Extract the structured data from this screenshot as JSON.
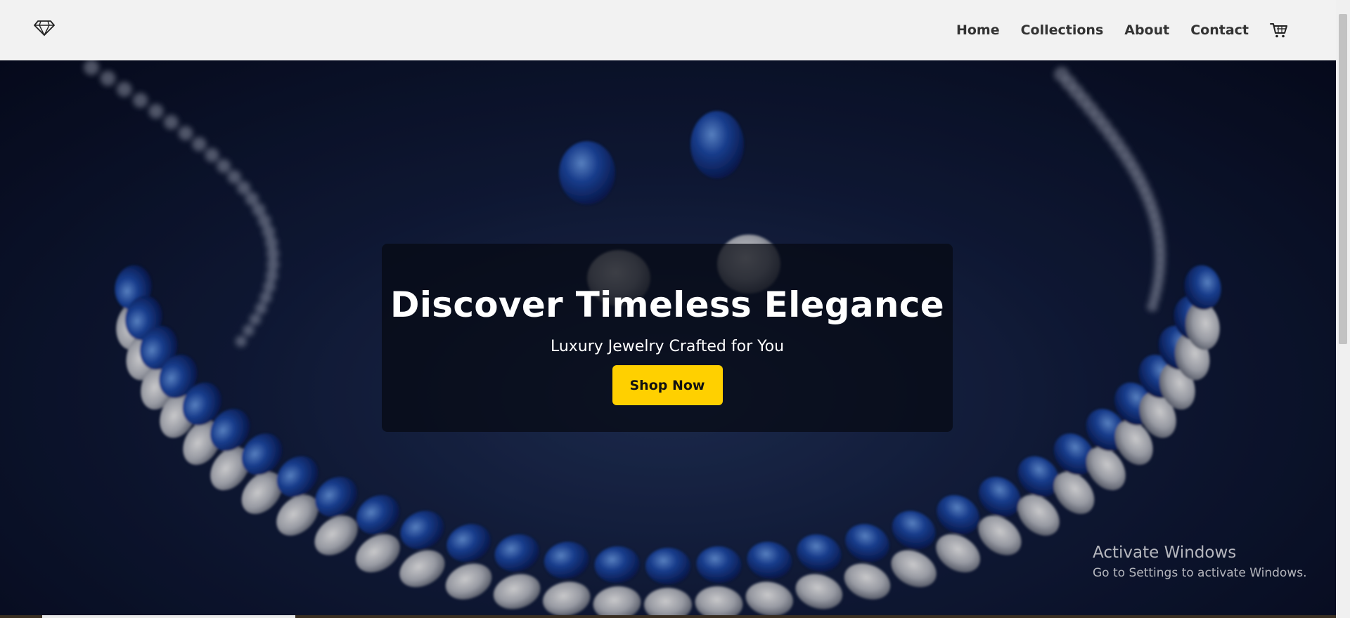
{
  "header": {
    "logo_icon": "diamond-icon",
    "nav": [
      {
        "label": "Home"
      },
      {
        "label": "Collections"
      },
      {
        "label": "About"
      },
      {
        "label": "Contact"
      }
    ],
    "cart_icon": "cart-icon"
  },
  "hero": {
    "title": "Discover Timeless Elegance",
    "subtitle": "Luxury Jewelry Crafted for You",
    "cta_label": "Shop Now",
    "cta_color": "#ffd000"
  },
  "watermark": {
    "title": "Activate Windows",
    "subtitle": "Go to Settings to activate Windows."
  },
  "colors": {
    "header_bg": "#f2f2f2",
    "nav_text": "#333333",
    "hero_bg": "#0b1126"
  }
}
